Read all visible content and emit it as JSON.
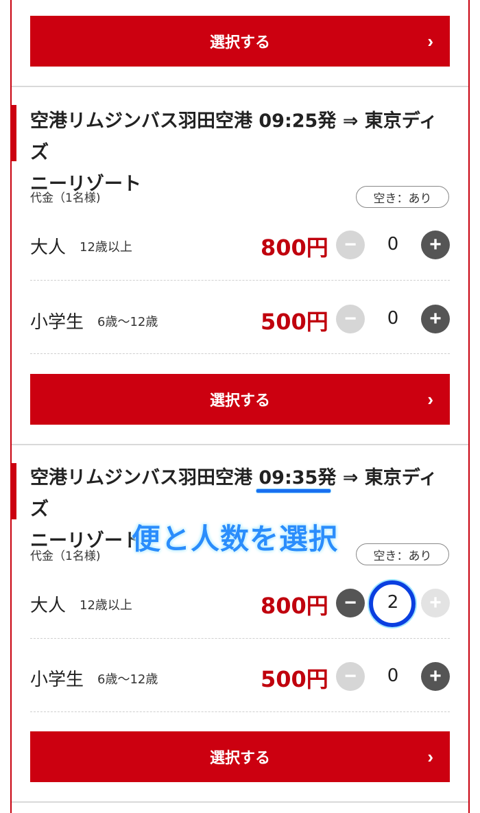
{
  "select_button_label": "選択する",
  "select_button_chevron": "›",
  "cards": [
    {
      "title_line1": "空港リムジンバス羽田空港 09:25発 ⇒ 東京ディズ",
      "title_line2": "ニーリゾート",
      "fare_label": "代金（1名様)",
      "availability": "空き：あり",
      "rows": [
        {
          "category": "大人",
          "sub": "12歳以上",
          "price": "800円",
          "qty": "0"
        },
        {
          "category": "小学生",
          "sub": "6歳〜12歳",
          "price": "500円",
          "qty": "0"
        }
      ]
    },
    {
      "title_line1": "空港リムジンバス羽田空港 09:35発 ⇒ 東京ディズ",
      "title_line2": "ニーリゾート",
      "fare_label": "代金（1名様)",
      "availability": "空き：あり",
      "rows": [
        {
          "category": "大人",
          "sub": "12歳以上",
          "price": "800円",
          "qty": "2"
        },
        {
          "category": "小学生",
          "sub": "6歳〜12歳",
          "price": "500円",
          "qty": "0"
        }
      ]
    }
  ],
  "stepper": {
    "minus": "−",
    "plus": "+"
  },
  "annotation": {
    "text": "便と人数を選択"
  },
  "colors": {
    "brand_red": "#cc0010",
    "price_red": "#c0000d",
    "annotation_blue": "#2a8dfc"
  }
}
